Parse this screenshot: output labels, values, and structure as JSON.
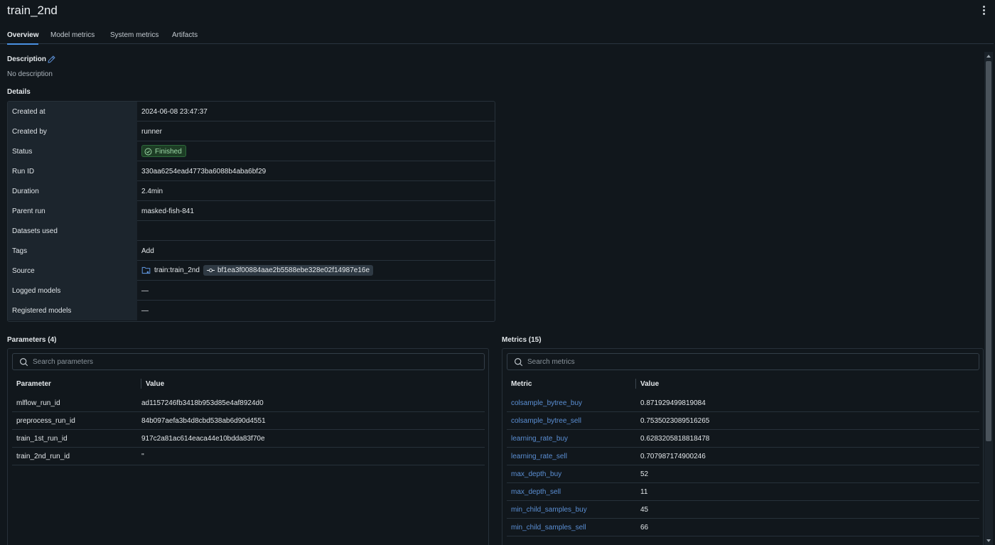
{
  "page": {
    "title": "train_2nd"
  },
  "tabs": [
    {
      "label": "Overview",
      "active": true
    },
    {
      "label": "Model metrics",
      "active": false
    },
    {
      "label": "System metrics",
      "active": false
    },
    {
      "label": "Artifacts",
      "active": false
    }
  ],
  "description": {
    "label": "Description",
    "value": "No description"
  },
  "details": {
    "label": "Details",
    "rows": {
      "created_at": {
        "key": "Created at",
        "value": "2024-06-08 23:47:37"
      },
      "created_by": {
        "key": "Created by",
        "value": "runner"
      },
      "status": {
        "key": "Status",
        "value": "Finished"
      },
      "run_id": {
        "key": "Run ID",
        "value": "330aa6254ead4773ba6088b4aba6bf29"
      },
      "duration": {
        "key": "Duration",
        "value": "2.4min"
      },
      "parent_run": {
        "key": "Parent run",
        "value": "masked-fish-841"
      },
      "datasets_used": {
        "key": "Datasets used",
        "value": ""
      },
      "tags": {
        "key": "Tags",
        "value": "Add"
      },
      "source": {
        "key": "Source",
        "value": "train:train_2nd",
        "commit": "bf1ea3f00884aae2b5588ebe328e02f14987e16e"
      },
      "logged_models": {
        "key": "Logged models",
        "value": "—"
      },
      "registered_models": {
        "key": "Registered models",
        "value": "—"
      }
    }
  },
  "parameters": {
    "title": "Parameters (4)",
    "search_placeholder": "Search parameters",
    "col_name": "Parameter",
    "col_value": "Value",
    "rows": [
      {
        "name": "mlflow_run_id",
        "value": "ad1157246fb3418b953d85e4af8924d0"
      },
      {
        "name": "preprocess_run_id",
        "value": "84b097aefa3b4d8cbd538ab6d90d4551"
      },
      {
        "name": "train_1st_run_id",
        "value": "917c2a81ac614eaca44e10bdda83f70e"
      },
      {
        "name": "train_2nd_run_id",
        "value": "''"
      }
    ]
  },
  "metrics": {
    "title": "Metrics (15)",
    "search_placeholder": "Search metrics",
    "col_name": "Metric",
    "col_value": "Value",
    "rows": [
      {
        "name": "colsample_bytree_buy",
        "value": "0.871929499819084"
      },
      {
        "name": "colsample_bytree_sell",
        "value": "0.7535023089516265"
      },
      {
        "name": "learning_rate_buy",
        "value": "0.6283205818818478"
      },
      {
        "name": "learning_rate_sell",
        "value": "0.707987174900246"
      },
      {
        "name": "max_depth_buy",
        "value": "52"
      },
      {
        "name": "max_depth_sell",
        "value": "11"
      },
      {
        "name": "min_child_samples_buy",
        "value": "45"
      },
      {
        "name": "min_child_samples_sell",
        "value": "66"
      }
    ]
  },
  "colors": {
    "background": "#11171c",
    "accent": "#4a90e2",
    "link": "#5b8fd4",
    "status_success": "#1d3d25"
  },
  "icons": {
    "menu": "kebab-vertical-icon",
    "edit": "pencil-icon",
    "status": "check-circle-icon",
    "source": "folder-branch-icon",
    "commit": "git-commit-icon",
    "search": "search-icon"
  }
}
